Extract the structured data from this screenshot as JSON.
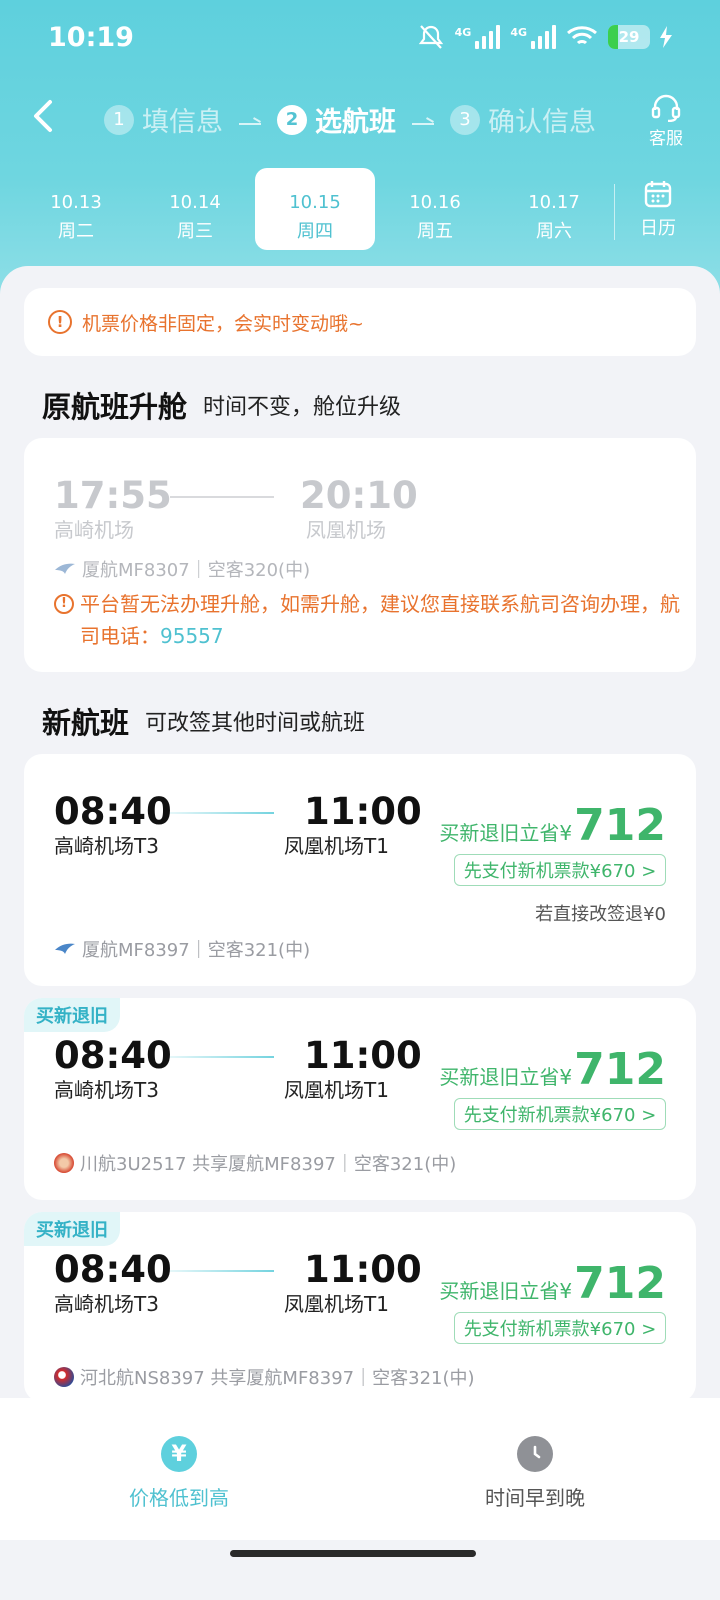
{
  "status_bar": {
    "time": "10:19",
    "network": "4G",
    "network2": "4G",
    "battery": "29"
  },
  "header": {
    "steps": [
      {
        "num": "1",
        "label": "填信息"
      },
      {
        "num": "2",
        "label": "选航班"
      },
      {
        "num": "3",
        "label": "确认信息"
      }
    ],
    "service_label": "客服"
  },
  "dates": [
    {
      "date": "10.13",
      "weekday": "周二"
    },
    {
      "date": "10.14",
      "weekday": "周三"
    },
    {
      "date": "10.15",
      "weekday": "周四"
    },
    {
      "date": "10.16",
      "weekday": "周五"
    },
    {
      "date": "10.17",
      "weekday": "周六"
    }
  ],
  "calendar_label": "日历",
  "notice": "机票价格非固定，会实时变动哦~",
  "original_section": {
    "title": "原航班升舱",
    "subtitle": "时间不变，舱位升级",
    "dep_time": "17:55",
    "dep_airport": "高崎机场",
    "arr_time": "20:10",
    "arr_airport": "凤凰机场",
    "flight_info": "厦航MF8307｜空客320(中)",
    "warning": "平台暂无法办理升舱，如需升舱，建议您直接联系航司咨询办理，航司电话：",
    "phone": "95557"
  },
  "new_section": {
    "title": "新航班",
    "subtitle": "可改签其他时间或航班"
  },
  "flights": [
    {
      "tag": "",
      "dep_time": "08:40",
      "dep_airport": "高崎机场T3",
      "arr_time": "11:00",
      "arr_airport": "凤凰机场T1",
      "save_label": "买新退旧立省¥",
      "save_amount": "712",
      "pay_label": "先支付新机票款¥670 >",
      "direct_label": "若直接改签退¥0",
      "flight_info": "厦航MF8397｜空客321(中)"
    },
    {
      "tag": "买新退旧",
      "dep_time": "08:40",
      "dep_airport": "高崎机场T3",
      "arr_time": "11:00",
      "arr_airport": "凤凰机场T1",
      "save_label": "买新退旧立省¥",
      "save_amount": "712",
      "pay_label": "先支付新机票款¥670 >",
      "flight_info": "川航3U2517 共享厦航MF8397｜空客321(中)"
    },
    {
      "tag": "买新退旧",
      "dep_time": "08:40",
      "dep_airport": "高崎机场T3",
      "arr_time": "11:00",
      "arr_airport": "凤凰机场T1",
      "save_label": "买新退旧立省¥",
      "save_amount": "712",
      "pay_label": "先支付新机票款¥670 >",
      "flight_info": "河北航NS8397 共享厦航MF8397｜空客321(中)"
    }
  ],
  "bottom": {
    "sort_price": "价格低到高",
    "sort_time": "时间早到晚"
  },
  "colors": {
    "accent": "#5ed0dd",
    "save_green": "#3fb56b",
    "warning_orange": "#e8732e"
  }
}
